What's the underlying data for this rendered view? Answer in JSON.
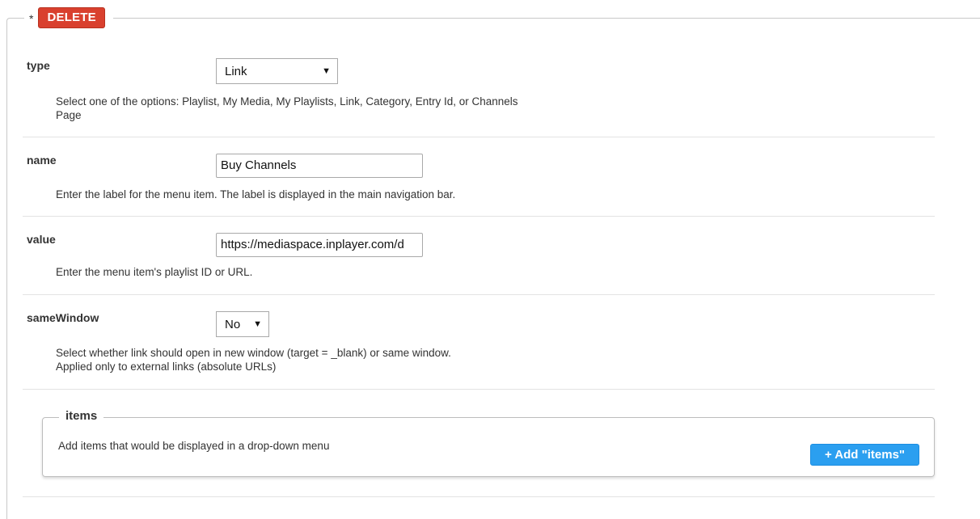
{
  "header": {
    "required_marker": "*",
    "delete_label": "DELETE"
  },
  "fields": [
    {
      "label": "type",
      "control": "select",
      "value": "Link",
      "help": "Select one of the options: Playlist, My Media, My Playlists, Link, Category, Entry Id, or Channels Page"
    },
    {
      "label": "name",
      "control": "text",
      "value": "Buy Channels",
      "help": "Enter the label for the menu item. The label is displayed in the main navigation bar."
    },
    {
      "label": "value",
      "control": "text",
      "value": "https://mediaspace.inplayer.com/d",
      "help": "Enter the menu item's playlist ID or URL."
    },
    {
      "label": "sameWindow",
      "control": "select",
      "value": "No",
      "help_line1": "Select whether link should open in new window (target = _blank) or same window.",
      "help_line2": "Applied only to external links (absolute URLs)"
    }
  ],
  "items": {
    "legend": "items",
    "help": "Add items that would be displayed in a drop-down menu",
    "add_button_label": "+ Add \"items\""
  },
  "colors": {
    "delete": "#d9402e",
    "add": "#2b9ff0"
  },
  "icons": {
    "caret": "chevron-down-icon"
  }
}
